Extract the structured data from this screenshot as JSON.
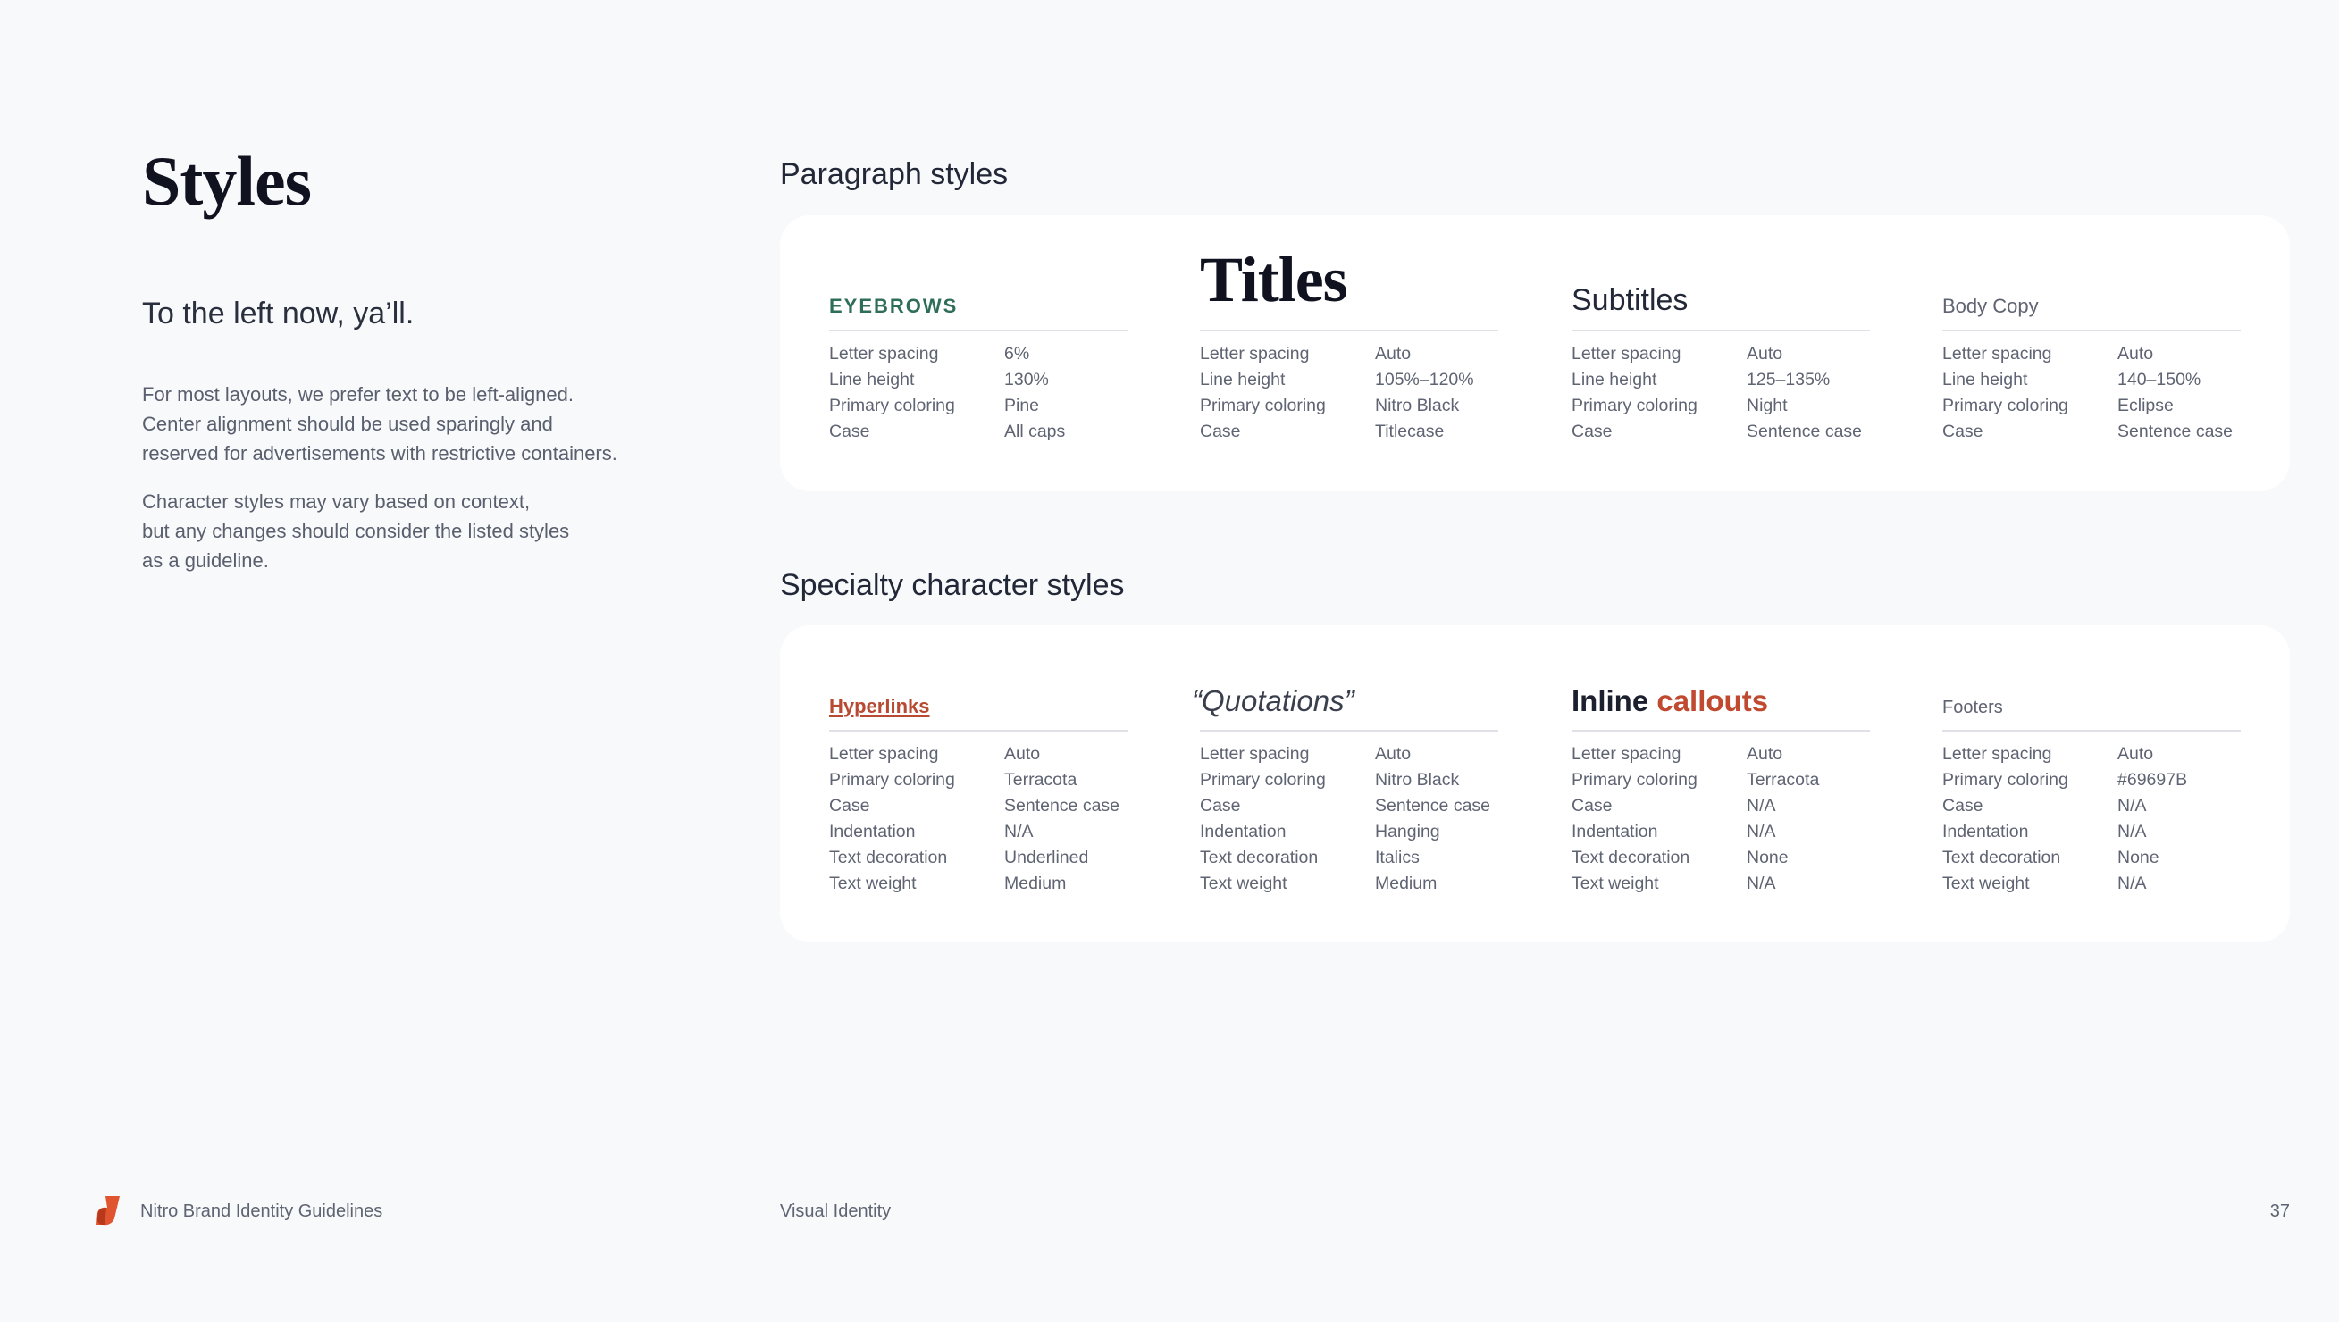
{
  "page": {
    "title": "Styles",
    "lead": "To the left now, ya’ll.",
    "paragraphs": [
      "For most layouts, we prefer text to be left-aligned.\nCenter alignment should be used sparingly and\nreserved for advertisements with restrictive containers.",
      "Character styles may vary based on context,\nbut any changes should consider the listed styles\nas a guideline."
    ]
  },
  "paragraph_styles": {
    "heading": "Paragraph styles",
    "labels": [
      "Letter spacing",
      "Line height",
      "Primary coloring",
      "Case"
    ],
    "columns": [
      {
        "name": "EYEBROWS",
        "values": [
          "6%",
          "130%",
          "Pine",
          "All caps"
        ]
      },
      {
        "name": "Titles",
        "values": [
          "Auto",
          "105%–120%",
          "Nitro Black",
          "Titlecase"
        ]
      },
      {
        "name": "Subtitles",
        "values": [
          "Auto",
          "125–135%",
          "Night",
          "Sentence case"
        ]
      },
      {
        "name": "Body Copy",
        "values": [
          "Auto",
          "140–150%",
          "Eclipse",
          "Sentence case"
        ]
      }
    ]
  },
  "specialty_styles": {
    "heading": "Specialty character styles",
    "labels": [
      "Letter spacing",
      "Primary coloring",
      "Case",
      "Indentation",
      "Text decoration",
      "Text weight"
    ],
    "columns": [
      {
        "name": "Hyperlinks",
        "values": [
          "Auto",
          "Terracota",
          "Sentence case",
          "N/A",
          "Underlined",
          "Medium"
        ]
      },
      {
        "name": "“Quotations”",
        "values": [
          "Auto",
          "Nitro Black",
          "Sentence case",
          "Hanging",
          "Italics",
          "Medium"
        ]
      },
      {
        "name_part1": "Inline ",
        "name_part2": "callouts",
        "values": [
          "Auto",
          "Terracota",
          "N/A",
          "N/A",
          "None",
          "N/A"
        ]
      },
      {
        "name": "Footers",
        "values": [
          "Auto",
          "#69697B",
          "N/A",
          "N/A",
          "None",
          "N/A"
        ]
      }
    ]
  },
  "footer": {
    "doc_title": "Nitro Brand Identity Guidelines",
    "section": "Visual Identity",
    "page_number": "37",
    "logo_icon": "nitro-logo-icon"
  },
  "colors": {
    "pine": "#2e6e58",
    "terracota": "#c04a30",
    "nitro_black": "#10131f",
    "footer_gray": "#69697B",
    "background": "#f8f9fb"
  }
}
